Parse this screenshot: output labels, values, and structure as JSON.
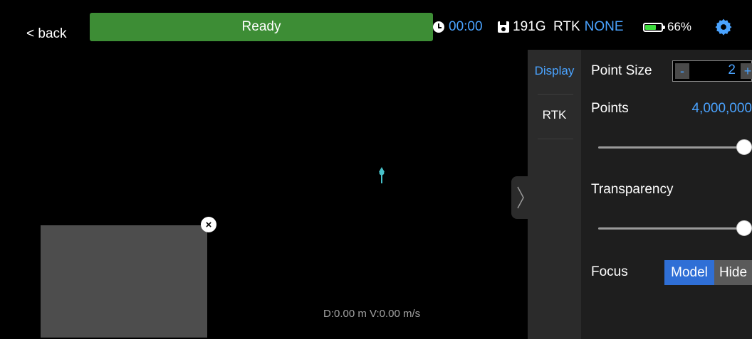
{
  "topbar": {
    "back_label": "< back",
    "status_label": "Ready",
    "status_color": "#3d8d35",
    "timer": "00:00",
    "storage": "191G",
    "rtk_label": "RTK",
    "rtk_value": "NONE",
    "battery": "66%",
    "battery_level": 0.66,
    "accent_color": "#4aa3ff",
    "settings_icon": "gear-icon"
  },
  "map": {
    "readout": "D:0.00 m V:0.00 m/s",
    "close_glyph": "×",
    "handle_glyph": "〉"
  },
  "tabs": {
    "display": "Display",
    "rtk": "RTK",
    "active": "display"
  },
  "settings": {
    "point_size_label": "Point Size",
    "point_size_minus": "-",
    "point_size_value": "2",
    "point_size_plus": "+",
    "points_label": "Points",
    "points_value": "4,000,000",
    "points_slider": 1.0,
    "transparency_label": "Transparency",
    "transparency_slider": 1.0,
    "focus_label": "Focus",
    "focus_options": [
      "Model",
      "Hide"
    ],
    "focus_selected": "Model"
  }
}
